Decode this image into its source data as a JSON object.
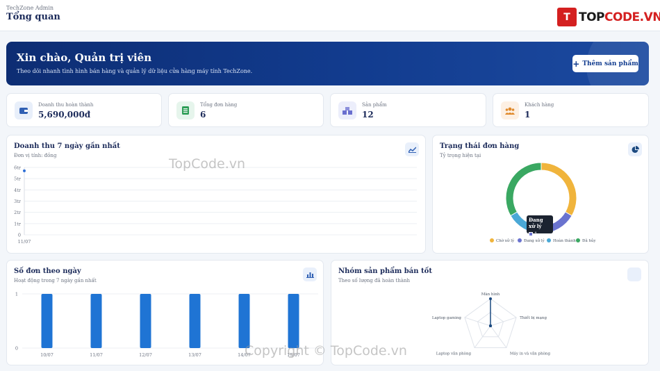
{
  "header": {
    "app_name": "TechZone Admin",
    "page_title": "Tổng quan"
  },
  "logo": {
    "mark": "T",
    "text_a": "TOP",
    "text_b": "CODE.VN"
  },
  "hero": {
    "title": "Xin chào, Quản trị viên",
    "subtitle": "Theo dõi nhanh tình hình bán hàng và quản lý dữ liệu cửa hàng máy tính TechZone.",
    "button_label": "Thêm sản phẩm"
  },
  "stats": [
    {
      "label": "Doanh thu hoàn thành",
      "value": "5,690,000đ",
      "icon": "wallet-icon",
      "color": "#2f5fb3",
      "bg": "#e8effa"
    },
    {
      "label": "Tổng đơn hàng",
      "value": "6",
      "icon": "receipt-icon",
      "color": "#2e9e57",
      "bg": "#e6f5ec"
    },
    {
      "label": "Sản phẩm",
      "value": "12",
      "icon": "boxes-icon",
      "color": "#6a6fcf",
      "bg": "#eceefb"
    },
    {
      "label": "Khách hàng",
      "value": "1",
      "icon": "users-icon",
      "color": "#e08a2c",
      "bg": "#fdf0e3"
    }
  ],
  "revenue_card": {
    "title": "Doanh thu 7 ngày gần nhất",
    "subtitle": "Đơn vị tính: đồng",
    "icon": "line-chart-icon"
  },
  "status_card": {
    "title": "Trạng thái đơn hàng",
    "subtitle": "Tỷ trọng hiện tại",
    "icon": "pie-chart-icon",
    "tooltip_title": "Đang xử lý",
    "tooltip_value": "1"
  },
  "orders_card": {
    "title": "Số đơn theo ngày",
    "subtitle": "Hoạt động trong 7 ngày gần nhất",
    "icon": "bar-chart-icon"
  },
  "top_card": {
    "title": "Nhóm sản phẩm bán tốt",
    "subtitle": "Theo số lượng đã hoàn thành"
  },
  "watermarks": {
    "center": "TopCode.vn",
    "bottom": "Copyright © TopCode.vn"
  },
  "chart_data": [
    {
      "type": "line",
      "x": [
        "11/07"
      ],
      "y": [
        5.7
      ],
      "yticks": [
        "0",
        "1tr",
        "2tr",
        "3tr",
        "4tr",
        "5tr",
        "6tr"
      ],
      "ylim": [
        0,
        6
      ],
      "grid": true,
      "color": "#2f6fd6"
    },
    {
      "type": "pie",
      "labels": [
        "Chờ xử lý",
        "Đang xử lý",
        "Hoàn thành",
        "Đã hủy"
      ],
      "values": [
        2,
        1,
        1,
        2
      ],
      "colors": [
        "#f0b43c",
        "#6a73cf",
        "#4aa8d6",
        "#3aa862"
      ],
      "legend": "bottom"
    },
    {
      "type": "bar",
      "categories": [
        "10/07",
        "11/07",
        "12/07",
        "13/07",
        "14/07",
        "15/07"
      ],
      "values": [
        1,
        1,
        1,
        1,
        1,
        1
      ],
      "ylim": [
        0,
        1
      ],
      "yticks": [
        "0",
        "1"
      ],
      "color": "#1f74d4"
    },
    {
      "type": "radar",
      "axes": [
        "Màn hình",
        "Thiết bị mạng",
        "Máy in và văn phòng",
        "Laptop văn phòng",
        "Laptop gaming"
      ],
      "values": [
        1,
        0,
        0,
        0,
        0
      ],
      "max": 1,
      "color": "#1c4a80"
    }
  ]
}
